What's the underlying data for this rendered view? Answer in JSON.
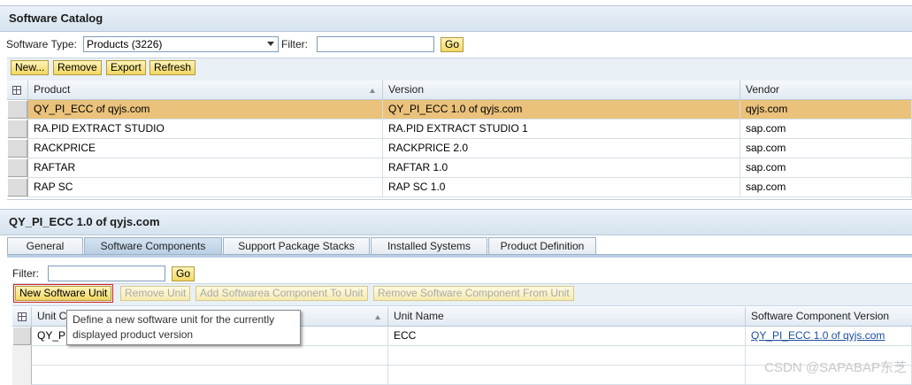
{
  "catalog": {
    "title": "Software Catalog",
    "software_type_label": "Software Type:",
    "software_type_value": "Products (3226)",
    "filter_label": "Filter:",
    "filter_value": "",
    "go_label": "Go",
    "toolbar": {
      "new": "New...",
      "remove": "Remove",
      "export": "Export",
      "refresh": "Refresh"
    },
    "columns": {
      "product": "Product",
      "version": "Version",
      "vendor": "Vendor"
    },
    "rows": [
      {
        "product": "QY_PI_ECC of qyjs.com",
        "version": "QY_PI_ECC 1.0 of qyjs.com",
        "vendor": "qyjs.com"
      },
      {
        "product": "RA.PID EXTRACT STUDIO",
        "version": "RA.PID EXTRACT STUDIO 1",
        "vendor": "sap.com"
      },
      {
        "product": "RACKPRICE",
        "version": "RACKPRICE 2.0",
        "vendor": "sap.com"
      },
      {
        "product": "RAFTAR",
        "version": "RAFTAR 1.0",
        "vendor": "sap.com"
      },
      {
        "product": "RAP SC",
        "version": "RAP SC 1.0",
        "vendor": "sap.com"
      }
    ]
  },
  "detail": {
    "title": "QY_PI_ECC 1.0 of qyjs.com",
    "tabs": [
      "General",
      "Software Components",
      "Support Package Stacks",
      "Installed Systems",
      "Product Definition"
    ],
    "filter_label": "Filter:",
    "filter_value": "",
    "go_label": "Go",
    "toolbar": {
      "new_unit": "New Software Unit",
      "remove_unit": "Remove Unit",
      "add_component": "Add Softwarea Component To Unit",
      "remove_component": "Remove Software Component From Unit"
    },
    "columns": {
      "unit_c": "Unit C",
      "unit_name": "Unit Name",
      "scv": "Software Component Version"
    },
    "rows": [
      {
        "unit_c": "QY_PI",
        "unit_name": "ECC",
        "scv": "QY_PI_ECC 1.0 of qyjs.com"
      }
    ],
    "tooltip_line1": "Define a new software unit for the currently",
    "tooltip_line2": "displayed product version"
  },
  "watermark": "CSDN @SAPABAP东芝",
  "colors": {
    "selected_row": "#eac27b",
    "button": "#f2d764",
    "header": "#d6e3ef"
  }
}
